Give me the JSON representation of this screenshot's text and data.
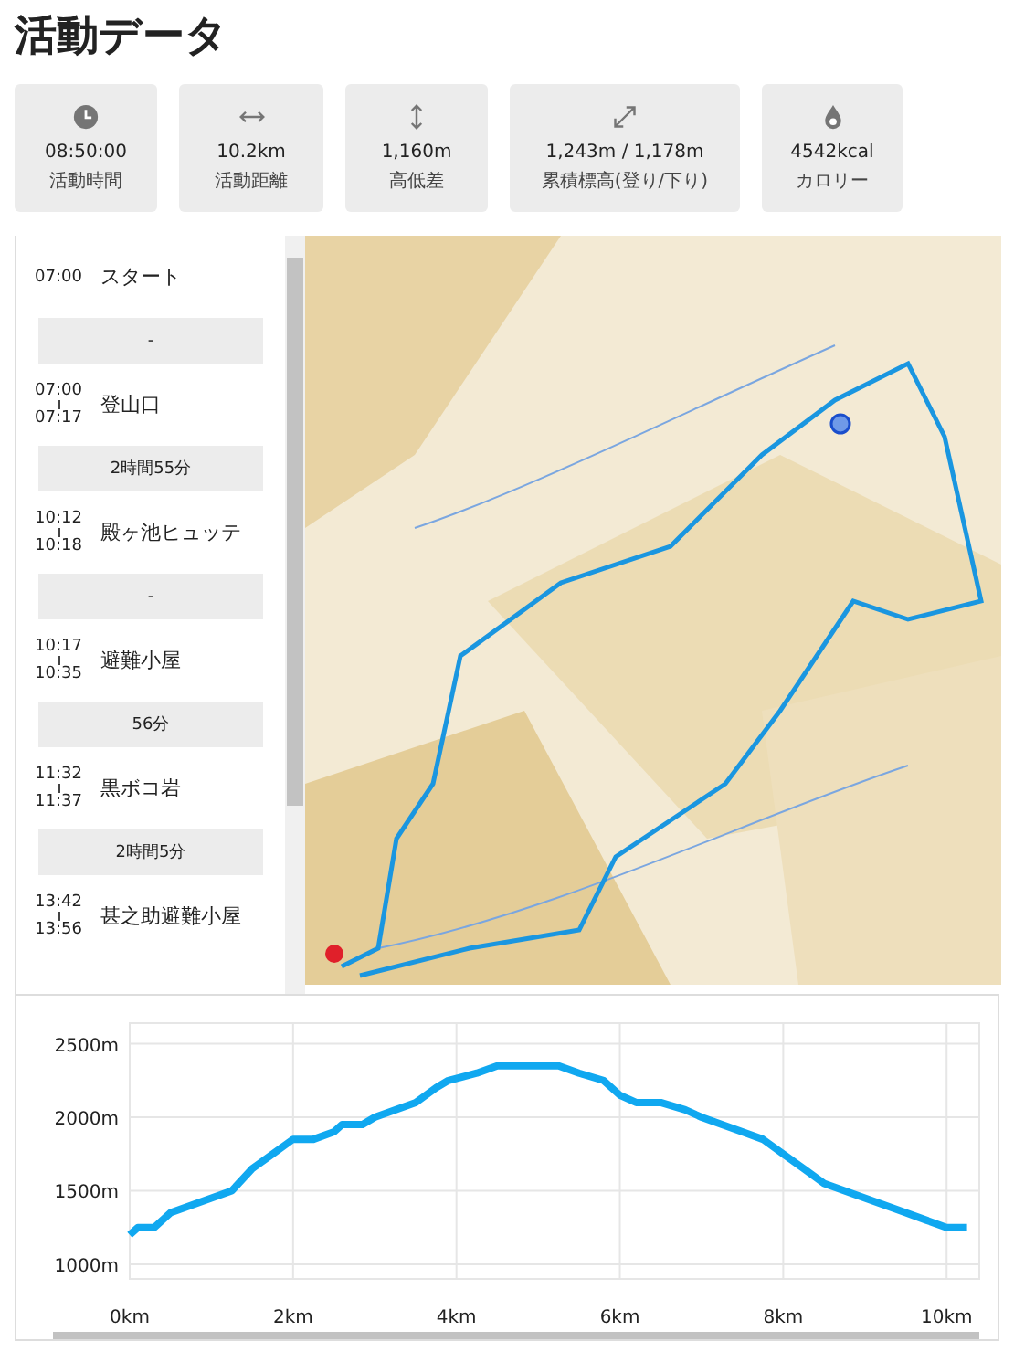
{
  "title": "活動データ",
  "stats": [
    {
      "value": "08:50:00",
      "label": "活動時間"
    },
    {
      "value": "10.2km",
      "label": "活動距離"
    },
    {
      "value": "1,160m",
      "label": "高低差"
    },
    {
      "value": "1,243m / 1,178m",
      "label": "累積標高(登り/下り)"
    },
    {
      "value": "4542kcal",
      "label": "カロリー"
    }
  ],
  "timeline": [
    {
      "kind": "stop",
      "times": [
        "07:00"
      ],
      "name": "スタート"
    },
    {
      "kind": "segment",
      "text": "-"
    },
    {
      "kind": "stop",
      "times": [
        "07:00",
        "07:17"
      ],
      "name": "登山口"
    },
    {
      "kind": "segment",
      "text": "2時間55分"
    },
    {
      "kind": "stop",
      "times": [
        "10:12",
        "10:18"
      ],
      "name": "殿ヶ池ヒュッテ"
    },
    {
      "kind": "segment",
      "text": "-"
    },
    {
      "kind": "stop",
      "times": [
        "10:17",
        "10:35"
      ],
      "name": "避難小屋"
    },
    {
      "kind": "segment",
      "text": "56分"
    },
    {
      "kind": "stop",
      "times": [
        "11:32",
        "11:37"
      ],
      "name": "黒ボコ岩"
    },
    {
      "kind": "segment",
      "text": "2時間5分"
    },
    {
      "kind": "stop",
      "times": [
        "13:42",
        "13:56"
      ],
      "name": "甚之助避難小屋"
    }
  ],
  "elevation": {
    "chart_data": {
      "type": "line",
      "x": [
        0,
        0.1,
        0.3,
        0.5,
        0.75,
        1,
        1.25,
        1.5,
        1.75,
        2,
        2.25,
        2.5,
        2.6,
        2.85,
        3,
        3.25,
        3.5,
        3.75,
        3.9,
        4.25,
        4.5,
        4.75,
        5,
        5.25,
        5.5,
        5.8,
        6,
        6.2,
        6.5,
        6.8,
        7,
        7.25,
        7.5,
        7.75,
        8,
        8.25,
        8.5,
        8.75,
        9,
        9.25,
        9.5,
        9.75,
        10,
        10.25
      ],
      "series": [
        {
          "color": "#10a8f0",
          "values": [
            1200,
            1250,
            1250,
            1350,
            1400,
            1450,
            1500,
            1650,
            1750,
            1850,
            1850,
            1900,
            1950,
            1950,
            2000,
            2050,
            2100,
            2200,
            2250,
            2300,
            2350,
            2350,
            2350,
            2350,
            2300,
            2250,
            2150,
            2100,
            2100,
            2050,
            2000,
            1950,
            1900,
            1850,
            1750,
            1650,
            1550,
            1500,
            1450,
            1400,
            1350,
            1300,
            1250,
            1250
          ]
        }
      ],
      "grid": true,
      "xlim": [
        0,
        10.4
      ],
      "ylim": [
        900,
        2640
      ],
      "xticks": [
        {
          "value": 0,
          "label": "0km"
        },
        {
          "value": 2,
          "label": "2km"
        },
        {
          "value": 4,
          "label": "4km"
        },
        {
          "value": 6,
          "label": "6km"
        },
        {
          "value": 8,
          "label": "8km"
        },
        {
          "value": 10,
          "label": "10km"
        }
      ],
      "yticks": [
        {
          "value": 1000,
          "label": "1000m"
        },
        {
          "value": 1500,
          "label": "1500m"
        },
        {
          "value": 2000,
          "label": "2000m"
        },
        {
          "value": 2500,
          "label": "2500m"
        }
      ]
    }
  }
}
